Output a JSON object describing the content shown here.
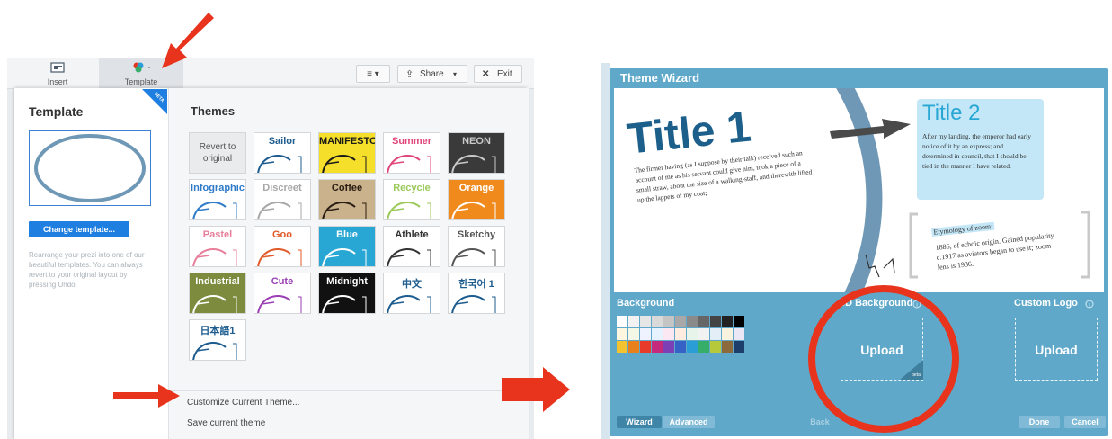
{
  "toolbar": {
    "insert_label": "Insert",
    "template_label": "Template",
    "menu_label": "≡ ▾",
    "share_label": "Share",
    "exit_label": "Exit",
    "beta_badge": "BETA"
  },
  "template_panel": {
    "title": "Template",
    "change_button": "Change template...",
    "description": "Rearrange your prezi into one of our beautiful templates. You can always revert to your original layout by pressing Undo."
  },
  "themes_panel": {
    "title": "Themes",
    "revert_label": "Revert to original",
    "tiles": [
      {
        "name": "Sailor",
        "bg": "#ffffff",
        "fg": "#1d5c8f"
      },
      {
        "name": "MANIFESTO",
        "bg": "#f6df2a",
        "fg": "#1a1a1a"
      },
      {
        "name": "Summer",
        "bg": "#ffffff",
        "fg": "#e0457b"
      },
      {
        "name": "NEON",
        "bg": "#3a3a3a",
        "fg": "#c9c9c9"
      },
      {
        "name": "Infographic",
        "bg": "#ffffff",
        "fg": "#2f7ac9"
      },
      {
        "name": "Discreet",
        "bg": "#ffffff",
        "fg": "#a7a7a7"
      },
      {
        "name": "Coffee",
        "bg": "#c9b28c",
        "fg": "#2a1d12"
      },
      {
        "name": "Recycle",
        "bg": "#ffffff",
        "fg": "#9bc95a"
      },
      {
        "name": "Orange",
        "bg": "#f18a1d",
        "fg": "#ffffff"
      },
      {
        "name": "Pastel",
        "bg": "#ffffff",
        "fg": "#e87e9a"
      },
      {
        "name": "Goo",
        "bg": "#ffffff",
        "fg": "#e05a2a"
      },
      {
        "name": "Blue",
        "bg": "#29a7d4",
        "fg": "#ffffff"
      },
      {
        "name": "Athlete",
        "bg": "#ffffff",
        "fg": "#333333"
      },
      {
        "name": "Sketchy",
        "bg": "#ffffff",
        "fg": "#555555"
      },
      {
        "name": "Industrial",
        "bg": "#7d8b3e",
        "fg": "#ffffff"
      },
      {
        "name": "Cute",
        "bg": "#ffffff",
        "fg": "#9a3fb4"
      },
      {
        "name": "Midnight",
        "bg": "#111111",
        "fg": "#ffffff"
      },
      {
        "name": "中文",
        "bg": "#ffffff",
        "fg": "#1d5c8f"
      },
      {
        "name": "한국어 1",
        "bg": "#ffffff",
        "fg": "#1d5c8f"
      },
      {
        "name": "日本語1",
        "bg": "#ffffff",
        "fg": "#1d5c8f"
      }
    ],
    "customize_label": "Customize Current Theme...",
    "save_label": "Save current theme"
  },
  "wizard": {
    "title": "Theme Wizard",
    "preview": {
      "title1": "Title 1",
      "title2": "Title 2",
      "body1": "The firmer having (as I suppose by their talk) received such an account of me as his servant could give him, took a piece of a small straw, about the size of a walking-staff, and therewith lifted up the lappets of my coat;",
      "body2": "After my landing, the emperor had early notice of it by an express; and determined in council, that I should be tied in the manner I have related.",
      "etymology_title": "Etymology of zoom:",
      "etymology_body": "1886, of echoic origin. Gained popularity c.1917 as aviators began to use it; zoom lens is 1936."
    },
    "background_label": "Background",
    "bg3d_label": "3D Background",
    "custom_logo_label": "Custom Logo",
    "upload_label": "Upload",
    "upload_label_2": "Upload",
    "beta_badge": "beta",
    "tab_wizard": "Wizard",
    "tab_advanced": "Advanced",
    "back_label": "Back",
    "done_label": "Done",
    "cancel_label": "Cancel",
    "swatches": [
      "#ffffff",
      "#f2f2f2",
      "#e6e6e6",
      "#d9d9d9",
      "#c4c4c4",
      "#a8a8a8",
      "#8a8a8a",
      "#666666",
      "#444444",
      "#222222",
      "#000000",
      "#fff6df",
      "#f4f6e6",
      "#eef3ff",
      "#e6f2ff",
      "#fbe7f1",
      "#ffece0",
      "#e7f4ea",
      "#f2f2f2",
      "#e4eef7",
      "#f7f3de",
      "#ebe7f4",
      "#f4c430",
      "#e8801c",
      "#e83a2a",
      "#c62a7b",
      "#7c3fb5",
      "#3562c4",
      "#2a9cd6",
      "#37ad6a",
      "#b6c93a",
      "#8c6a3c",
      "#1d3e6a"
    ]
  }
}
